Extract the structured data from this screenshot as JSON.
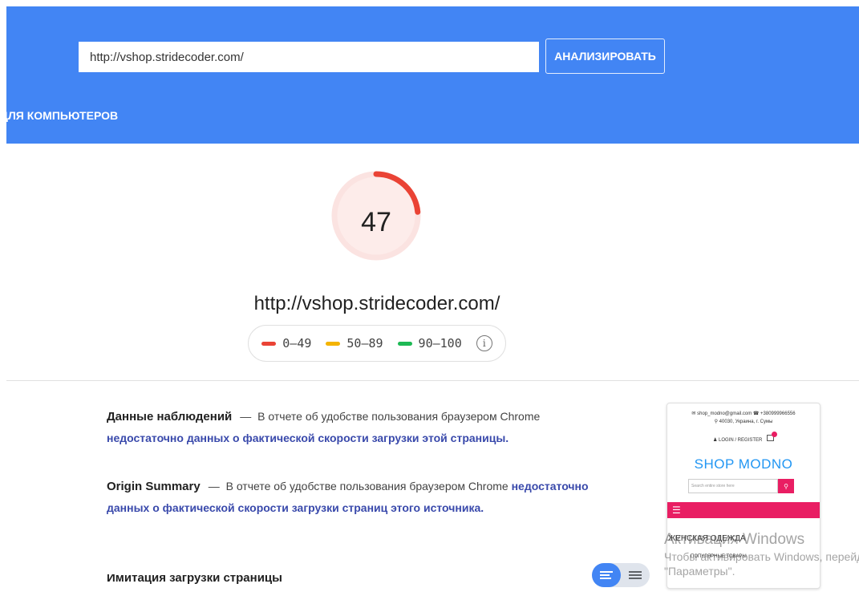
{
  "header": {
    "url_value": "http://vshop.stridecoder.com/",
    "analyze_label": "АНАЛИЗИРОВАТЬ",
    "desktop_tab": "ДЛЯ КОМПЬЮТЕРОВ"
  },
  "score": {
    "value": "47",
    "fraction": 0.47,
    "color": "#ea4335",
    "url": "http://vshop.stridecoder.com/"
  },
  "legend": {
    "items": [
      {
        "range": "0–49",
        "color": "#ea4335"
      },
      {
        "range": "50–89",
        "color": "#f4b400"
      },
      {
        "range": "90–100",
        "color": "#1db954"
      }
    ],
    "info_icon": "info-icon"
  },
  "field_data": {
    "title": "Данные наблюдений",
    "dash": "—",
    "text": "В отчете об удобстве пользования браузером Chrome",
    "link": "недостаточно данных о фактической скорости загрузки этой страницы."
  },
  "origin_summary": {
    "title": "Origin Summary",
    "dash": "—",
    "text": "В отчете об удобстве пользования браузером Chrome",
    "link": "недостаточно данных о фактической скорости загрузки страниц этого источника."
  },
  "next_section": {
    "title": "Имитация загрузки страницы"
  },
  "toggle": {
    "icons": [
      "summary-view-icon",
      "list-view-icon"
    ]
  },
  "screenshot": {
    "contact": "✉ shop_modno@gmail.com  ☎ +380999966556",
    "address": "⚲ 40030, Украина, г. Сумы",
    "login": "♟ LOGIN / REGISTER",
    "logo": "SHOP MODNO",
    "search_placeholder": "Search entire store here",
    "category": "ЖЕНСКАЯ ОДЕЖДА",
    "popular": "ПОПУЛЯРНЫЕ ТОВАРЫ"
  },
  "watermark": {
    "line1": "Активация Windows",
    "line2": "Чтобы активировать Windows, перейди",
    "line3": "\"Параметры\"."
  }
}
